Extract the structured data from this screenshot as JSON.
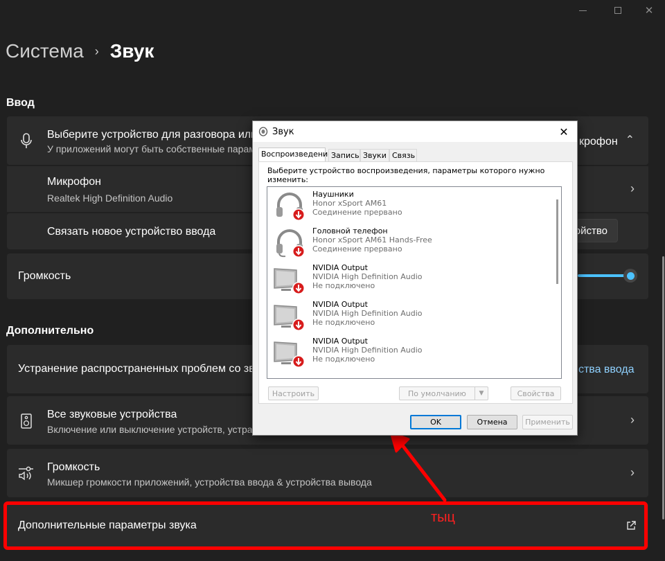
{
  "window": {
    "min_icon": "minimize-icon",
    "max_icon": "maximize-icon",
    "close_icon": "close-icon",
    "close_glyph": "✕"
  },
  "breadcrumb": {
    "parent": "Система",
    "separator": "›",
    "current": "Звук"
  },
  "input_section": {
    "title": "Ввод",
    "choose_device": {
      "title": "Выберите устройство для разговора или записи",
      "subtitle": "У приложений могут быть собственные параметры",
      "value": "Микрофон",
      "value_prefix": "кр",
      "value_visible": "крофон",
      "chevron": "⌃"
    },
    "microphone": {
      "title": "Микрофон",
      "subtitle": "Realtek High Definition Audio",
      "chevron": "›"
    },
    "pair_device": {
      "title": "Связать новое устройство ввода",
      "button": "ойство"
    },
    "volume": {
      "title": "Громкость",
      "level": 100
    }
  },
  "advanced_section": {
    "title": "Дополнительно",
    "troubleshoot": {
      "title": "Устранение распространенных проблем со звуком",
      "link": "йства ввода"
    },
    "all_devices": {
      "title": "Все звуковые устройства",
      "subtitle": "Включение или выключение устройств, устранение неполадок и другие параметры",
      "chevron": "›"
    },
    "volume_mixer": {
      "title": "Громкость",
      "subtitle": "Микшер громкости приложений, устройства ввода & устройства вывода",
      "chevron": "›"
    },
    "more_settings": {
      "title": "Дополнительные параметры звука",
      "icon": "external-link-icon"
    }
  },
  "annotation": {
    "text": "тыц",
    "color": "#ff0000"
  },
  "dialog": {
    "title": "Звук",
    "close": "✕",
    "tabs": [
      "Воспроизведение",
      "Запись",
      "Звуки",
      "Связь"
    ],
    "description": "Выберите устройство воспроизведения, параметры которого нужно изменить:",
    "devices": [
      {
        "name": "Наушники",
        "driver": "Honor xSport AM61",
        "status": "Соединение прервано",
        "icon": "headphones-icon"
      },
      {
        "name": "Головной телефон",
        "driver": "Honor xSport AM61 Hands-Free",
        "status": "Соединение прервано",
        "icon": "headset-icon"
      },
      {
        "name": "NVIDIA Output",
        "driver": "NVIDIA High Definition Audio",
        "status": "Не подключено",
        "icon": "monitor-icon"
      },
      {
        "name": "NVIDIA Output",
        "driver": "NVIDIA High Definition Audio",
        "status": "Не подключено",
        "icon": "monitor-icon"
      },
      {
        "name": "NVIDIA Output",
        "driver": "NVIDIA High Definition Audio",
        "status": "Не подключено",
        "icon": "monitor-icon"
      }
    ],
    "buttons": {
      "configure": "Настроить",
      "set_default": "По умолчанию",
      "properties": "Свойства",
      "ok": "OK",
      "cancel": "Отмена",
      "apply": "Применить"
    }
  },
  "colors": {
    "accent": "#4cc2ff",
    "background": "#202020",
    "card": "#2b2b2b",
    "highlight": "#ff0000",
    "link": "#8fd1ff"
  }
}
